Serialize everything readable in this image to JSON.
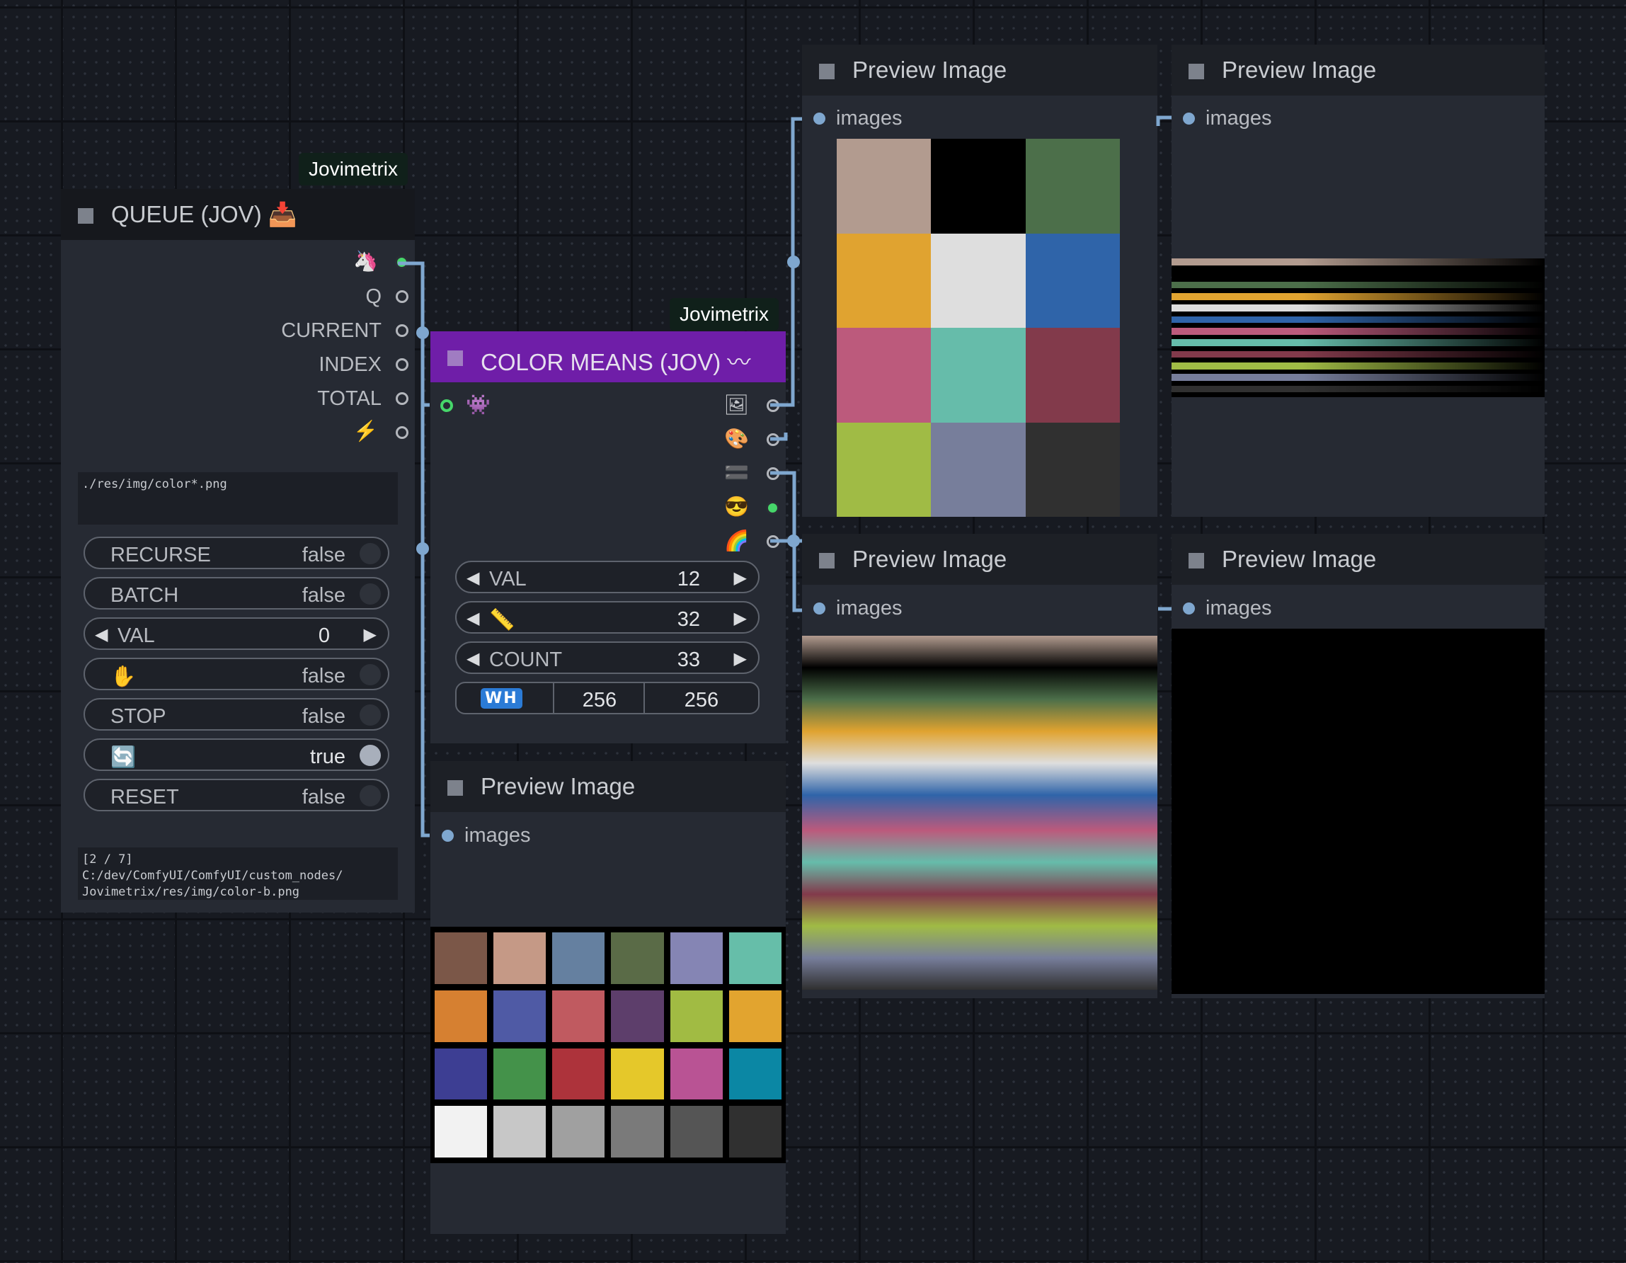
{
  "badges": {
    "queue": "Jovimetrix",
    "color_means": "Jovimetrix"
  },
  "queue_node": {
    "title": "QUEUE (JOV)",
    "title_icon": "tray-icon",
    "outputs": [
      {
        "icon": "unicorn-icon",
        "label": "",
        "connected": true
      },
      {
        "label": "Q",
        "connected": false
      },
      {
        "label": "CURRENT",
        "connected": true
      },
      {
        "label": "INDEX",
        "connected": false
      },
      {
        "label": "TOTAL",
        "connected": false
      },
      {
        "icon": "lightning-icon",
        "label": "",
        "connected": false
      }
    ],
    "path_text": "./res/img/color*.png",
    "widgets": {
      "recurse": {
        "label": "RECURSE",
        "value": "false"
      },
      "batch": {
        "label": "BATCH",
        "value": "false"
      },
      "val": {
        "label": "VAL",
        "value": "0"
      },
      "hold": {
        "icon": "hand-icon",
        "value": "false"
      },
      "stop": {
        "label": "STOP",
        "value": "false"
      },
      "loop": {
        "icon": "repeat-icon",
        "value": "true"
      },
      "reset": {
        "label": "RESET",
        "value": "false"
      }
    },
    "status_text": "[2 / 7]\nC:/dev/ComfyUI/ComfyUI/custom_nodes/\nJovimetrix/res/img/color-b.png"
  },
  "color_means_node": {
    "title": "COLOR MEANS (JOV)",
    "title_icon": "wave-icon",
    "input_icon": "alien-monster-icon",
    "output_icons": [
      "framed-picture-icon",
      "palette-icon",
      "flag-bars-icon",
      "sunglasses-icon",
      "rainbow-icon"
    ],
    "widgets": {
      "val": {
        "label": "VAL",
        "value": "12"
      },
      "ruler": {
        "icon": "ruler-icon",
        "value": "32"
      },
      "count": {
        "label": "COUNT",
        "value": "33"
      },
      "wh": {
        "icon": "wh-icon",
        "width": "256",
        "height": "256"
      }
    }
  },
  "preview_nodes": {
    "title": "Preview Image",
    "input_label": "images"
  },
  "palette_3x4": [
    "#b29b8f",
    "#000000",
    "#4c6f4a",
    "#e0a330",
    "#dedede",
    "#2f64a9",
    "#bc5a7c",
    "#66bcaa",
    "#823a4b",
    "#a0bb45",
    "#777e9b",
    "#303030"
  ],
  "palette_6x4": [
    "#7b5748",
    "#c59986",
    "#6580a0",
    "#5a6b47",
    "#8585b4",
    "#66bea9",
    "#d68031",
    "#4f5aa5",
    "#c05a60",
    "#5d3e6b",
    "#a1bb43",
    "#e2a42f",
    "#3d3e93",
    "#44924a",
    "#ad333b",
    "#e5c82a",
    "#b95394",
    "#0b87a4",
    "#f2f2f2",
    "#c7c7c7",
    "#a0a0a0",
    "#7a7a7a",
    "#555555",
    "#303030"
  ],
  "stripe_colors": [
    "#b29b8f",
    "#000000",
    "#4c6f4a",
    "#e0a330",
    "#dedede",
    "#2f64a9",
    "#bc5a7c",
    "#66bcaa",
    "#823a4b",
    "#a0bb45",
    "#777e9b",
    "#303030"
  ],
  "colors": {
    "background": "#171a21",
    "node_body": "#262a33",
    "node_title": "#1d2026",
    "color_means_title": "#6f1ea8",
    "wire": "#7fa7cf",
    "connected_slot": "#46d66a"
  }
}
